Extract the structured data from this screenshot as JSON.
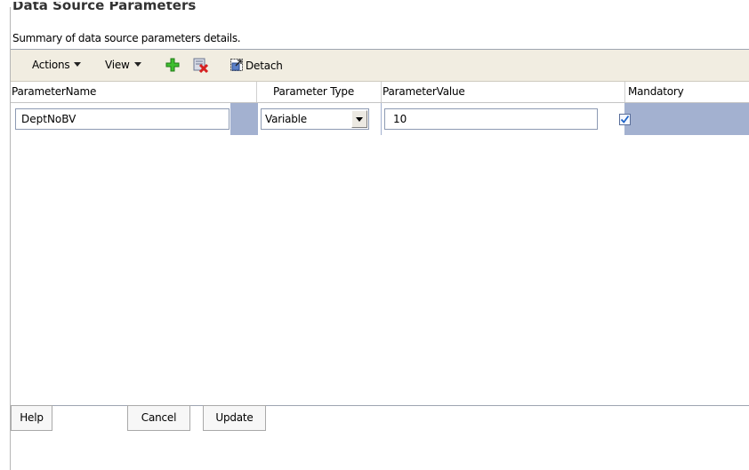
{
  "page": {
    "title": "Data Source Parameters",
    "subtitle": "Summary of data source parameters details."
  },
  "toolbar": {
    "actions_label": "Actions",
    "view_label": "View",
    "add_icon": "green-plus-icon",
    "delete_icon": "red-x-delete-icon",
    "detach_icon": "detach-window-icon",
    "detach_label": "Detach"
  },
  "table": {
    "columns": [
      "ParameterName",
      "Parameter Type",
      "ParameterValue",
      "Mandatory"
    ],
    "rows": [
      {
        "parameter_name": "DeptNoBV",
        "parameter_type": "Variable",
        "parameter_value": "10",
        "mandatory": true
      }
    ]
  },
  "buttons": {
    "help": "Help",
    "cancel": "Cancel",
    "update": "Update"
  },
  "colors": {
    "toolbar_bg": "#f1ede1",
    "selected_row": "#a3b1d0",
    "checkmark": "#1e64c8"
  }
}
